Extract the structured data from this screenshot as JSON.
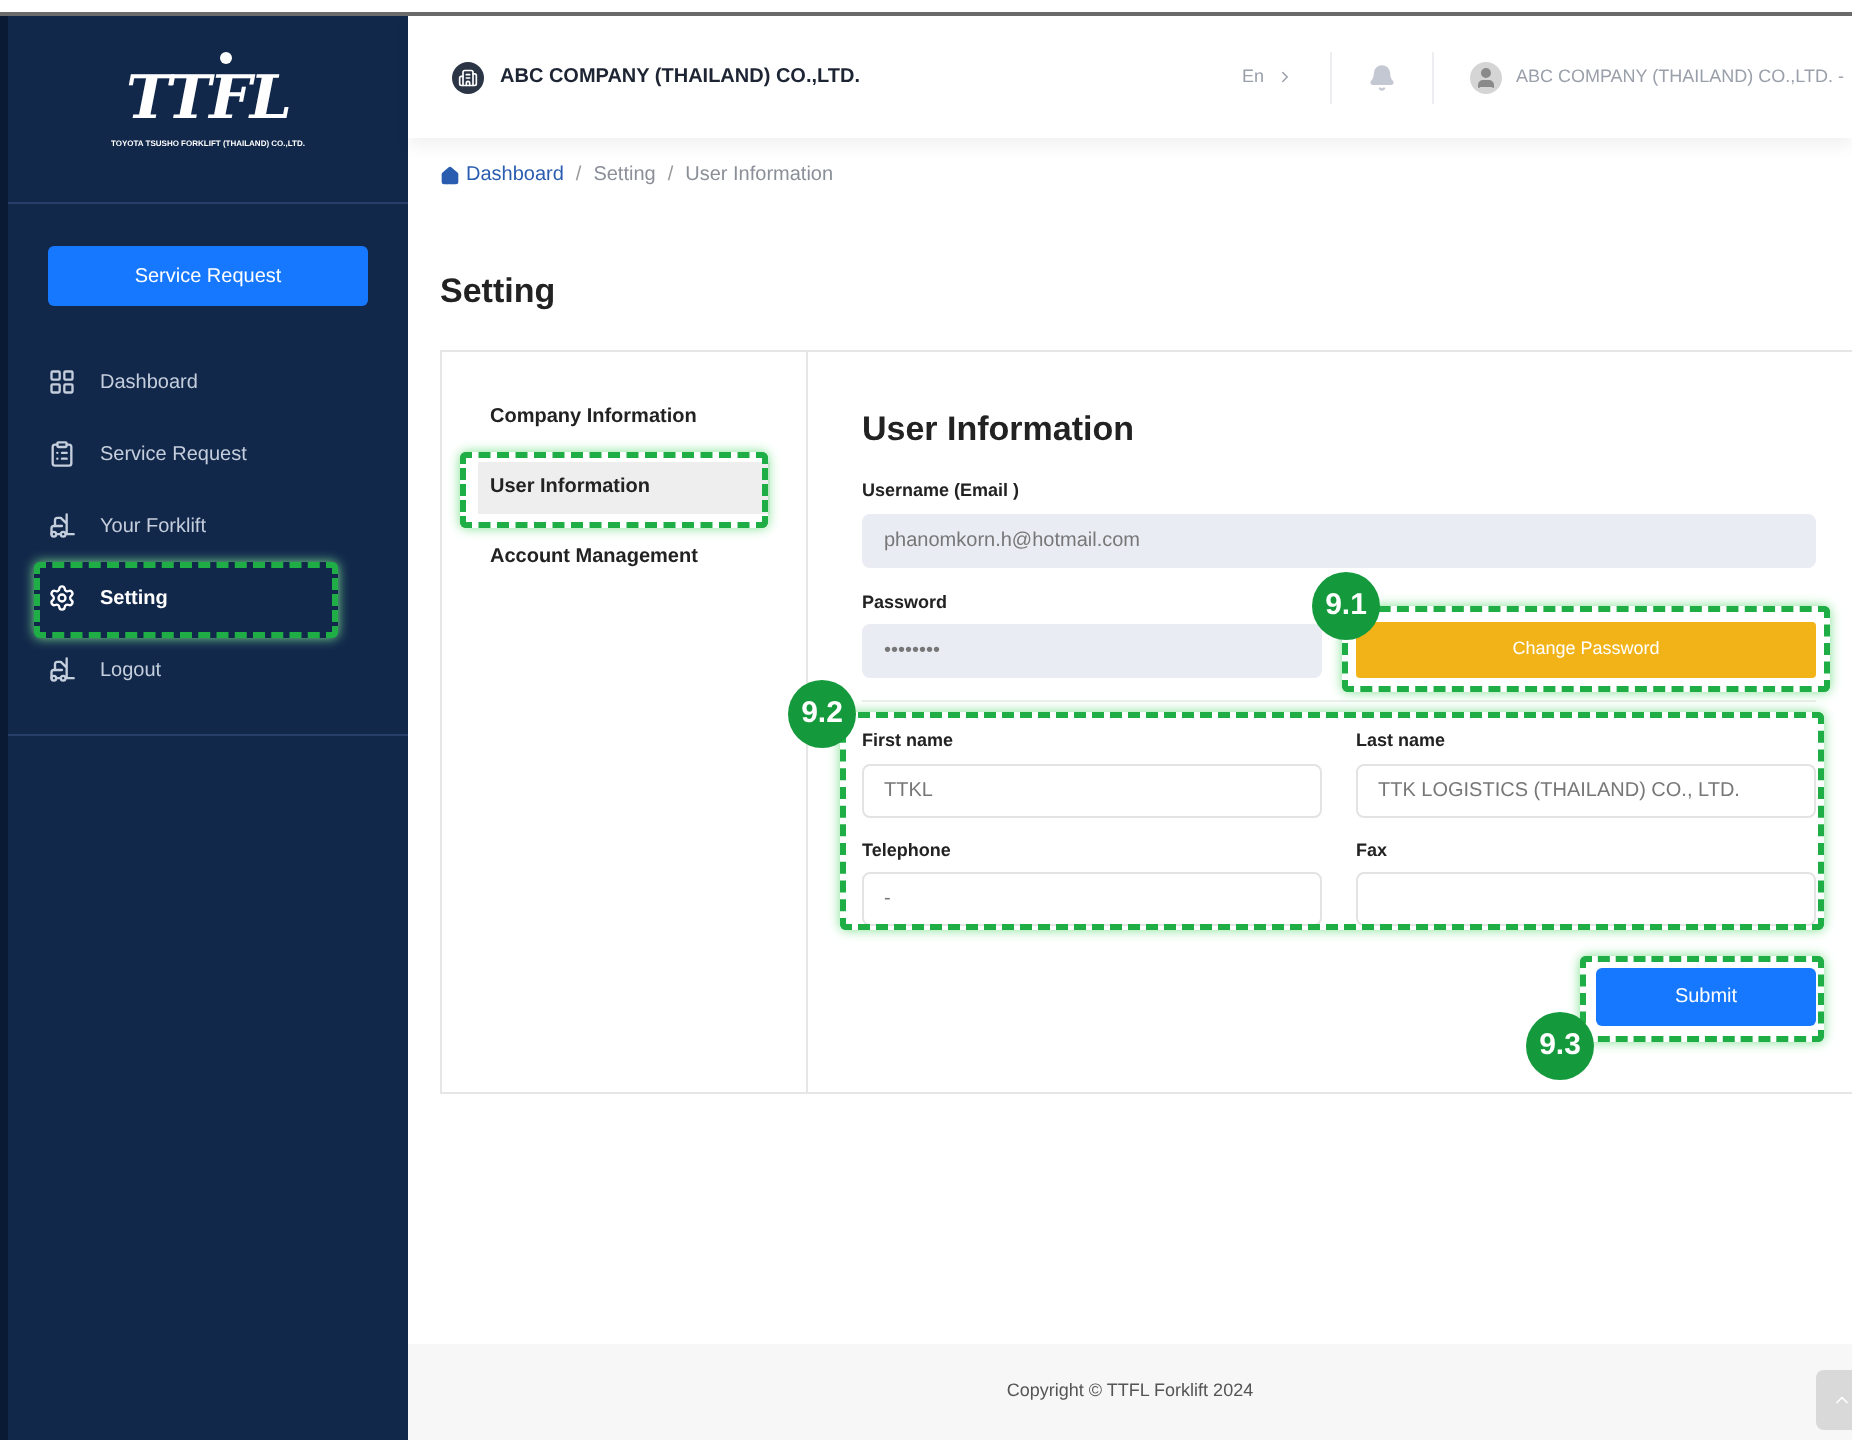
{
  "logo": {
    "mark": "TTFL",
    "tagline": "TOYOTA TSUSHO FORKLIFT (THAILAND) CO.,LTD."
  },
  "sidebar": {
    "action_button": "Service Request",
    "items": [
      {
        "label": "Dashboard",
        "kind": "grid",
        "selected": false,
        "annotated": false
      },
      {
        "label": "Service Request",
        "kind": "clipboard",
        "selected": false,
        "annotated": false
      },
      {
        "label": "Your Forklift",
        "kind": "forklift",
        "selected": false,
        "annotated": false
      },
      {
        "label": "Setting",
        "kind": "gear",
        "selected": true,
        "annotated": true
      },
      {
        "label": "Logout",
        "kind": "forklift",
        "selected": false,
        "annotated": false
      }
    ]
  },
  "header": {
    "company": "ABC COMPANY (THAILAND) CO.,LTD.",
    "language": "En",
    "user": "ABC COMPANY (THAILAND) CO.,LTD. -"
  },
  "breadcrumb": {
    "separator": "/",
    "items": [
      {
        "label": "Dashboard",
        "kind": "link"
      },
      {
        "label": "Setting",
        "kind": "text"
      },
      {
        "label": "User Information",
        "kind": "text"
      }
    ]
  },
  "page_title": "Setting",
  "settings_nav": [
    {
      "label": "Company Information",
      "selected": false,
      "annotated": false
    },
    {
      "label": "User Information",
      "selected": true,
      "annotated": true
    },
    {
      "label": "Account Management",
      "selected": false,
      "annotated": false
    }
  ],
  "form": {
    "title": "User Information",
    "username": {
      "label": "Username (Email )",
      "value": "phanomkorn.h@hotmail.com",
      "disabled": true
    },
    "password": {
      "label": "Password",
      "value": "••••••••",
      "disabled": true
    },
    "change_password": {
      "label": "Change Password",
      "callout": "9.1"
    },
    "contact": {
      "callout": "9.2",
      "fields": [
        {
          "label": "First name",
          "value": "TTKL",
          "disabled": false
        },
        {
          "label": "Last name",
          "value": "TTK LOGISTICS (THAILAND) CO., LTD.",
          "disabled": false
        },
        {
          "label": "Telephone",
          "value": "-",
          "disabled": false
        },
        {
          "label": "Fax",
          "disabled": false
        }
      ]
    },
    "submit": {
      "label": "Submit",
      "callout": "9.3"
    }
  },
  "footer": "Copyright © TTFL Forklift 2024"
}
